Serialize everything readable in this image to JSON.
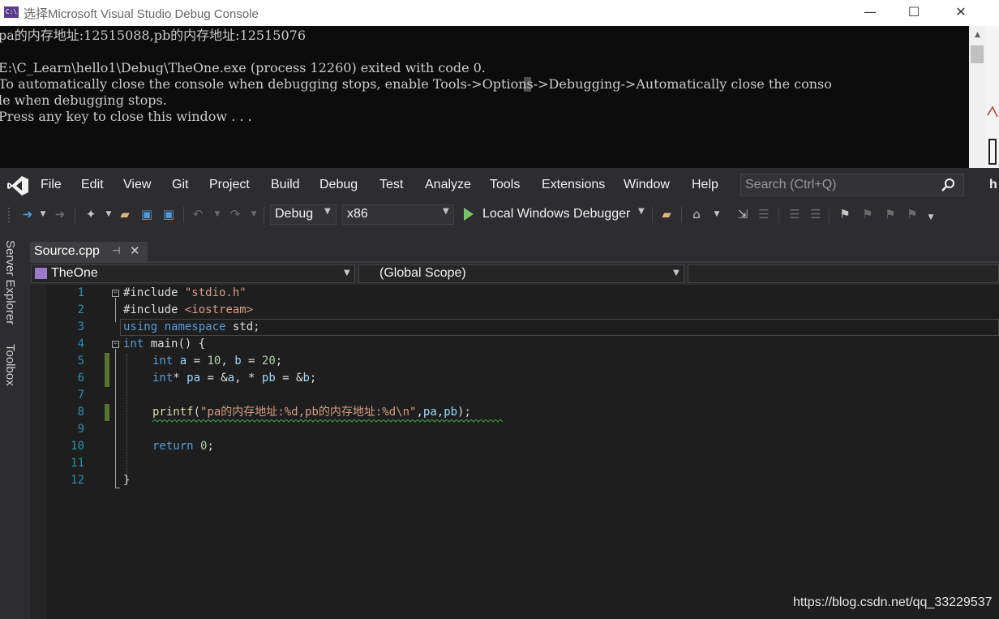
{
  "console": {
    "icon_text": "C:\\",
    "title": "选择Microsoft Visual Studio Debug Console",
    "window_buttons": {
      "minimize": "—",
      "maximize": "☐",
      "close": "✕"
    },
    "lines": [
      "pa的内存地址:12515088,pb的内存地址:12515076",
      "",
      "E:\\C_Learn\\hello1\\Debug\\TheOne.exe (process 12260) exited with code 0.",
      "To automatically close the console when debugging stops, enable Tools->Options->Debugging->Automatically close the conso",
      "le when debugging stops.",
      "Press any key to close this window . . ."
    ]
  },
  "menu": {
    "items": [
      "File",
      "Edit",
      "View",
      "Git",
      "Project",
      "Build",
      "Debug",
      "Test",
      "Analyze",
      "Tools",
      "Extensions",
      "Window",
      "Help"
    ],
    "search_placeholder": "Search (Ctrl+Q)",
    "user_initial": "h"
  },
  "toolbar": {
    "configuration": "Debug",
    "platform": "x86",
    "debugger": "Local Windows Debugger"
  },
  "side_panels": [
    "Server Explorer",
    "Toolbox"
  ],
  "document": {
    "tab": "Source.cpp",
    "nav_project": "TheOne",
    "nav_scope": "(Global Scope)"
  },
  "editor": {
    "line_numbers": [
      "1",
      "2",
      "3",
      "4",
      "5",
      "6",
      "7",
      "8",
      "9",
      "10",
      "11",
      "12"
    ],
    "lines": {
      "l1": {
        "pre": "#include ",
        "str": "\"stdio.h\""
      },
      "l2": {
        "pre": "#include ",
        "str": "<iostream>"
      },
      "l3": {
        "kw1": "using",
        "kw2": "namespace",
        "rest": " std;"
      },
      "l4": {
        "kw": "int",
        "rest": " main() {"
      },
      "l5": {
        "kw": "int",
        "v1": "a",
        "n1": "10",
        "v2": "b",
        "n2": "20",
        "eq1": " = ",
        "comma": ", ",
        "eq2": " = ",
        "end": ";"
      },
      "l6": {
        "kw": "int",
        "star": "* ",
        "v1": "pa",
        "mid1": " = &",
        "v2": "a",
        "mid2": ", * ",
        "v3": "pb",
        "mid3": " = &",
        "v4": "b",
        "end": ";"
      },
      "l8": {
        "fn": "printf",
        "open": "(",
        "str": "\"pa的内存地址:%d,pb的内存地址:%d\\n\"",
        "c1": ",",
        "a1": "pa",
        "c2": ",",
        "a2": "pb",
        "end": ");"
      },
      "l10": {
        "kw": "return",
        "sp": " ",
        "num": "0",
        "end": ";"
      },
      "l12": {
        "brace": "}"
      }
    }
  },
  "watermark": "https://blog.csdn.net/qq_33229537",
  "colors": {
    "console_bg": "#0c0c0c",
    "vs_chrome": "#2d2d30",
    "editor_bg": "#1e1e1e",
    "keyword": "#569cd6",
    "string": "#d69d85",
    "line_number": "#2b91af",
    "change_marker": "#577430",
    "vs_accent": "#68217a"
  }
}
